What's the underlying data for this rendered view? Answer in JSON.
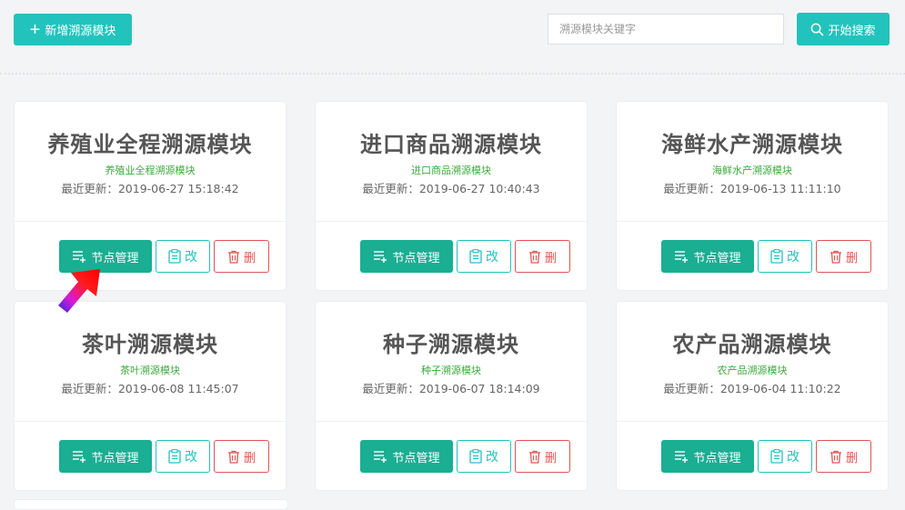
{
  "toolbar": {
    "add_label": "新增溯源模块",
    "search_placeholder": "溯源模块关键字",
    "search_label": "开始搜索"
  },
  "card_actions": {
    "node_label": "节点管理",
    "edit_label": "改",
    "delete_label": "删"
  },
  "cards": [
    {
      "title": "养殖业全程溯源模块",
      "subtitle": "养殖业全程溯源模块",
      "updated": "最近更新：2019-06-27 15:18:42"
    },
    {
      "title": "进口商品溯源模块",
      "subtitle": "进口商品溯源模块",
      "updated": "最近更新：2019-06-27 10:40:43"
    },
    {
      "title": "海鲜水产溯源模块",
      "subtitle": "海鲜水产溯源模块",
      "updated": "最近更新：2019-06-13 11:11:10"
    },
    {
      "title": "茶叶溯源模块",
      "subtitle": "茶叶溯源模块",
      "updated": "最近更新：2019-06-08 11:45:07"
    },
    {
      "title": "种子溯源模块",
      "subtitle": "种子溯源模块",
      "updated": "最近更新：2019-06-07 18:14:09"
    },
    {
      "title": "农产品溯源模块",
      "subtitle": "农产品溯源模块",
      "updated": "最近更新：2019-06-04 11:10:22"
    }
  ],
  "icons": {
    "add": "plus-icon",
    "search": "search-icon",
    "node": "list-plus-icon",
    "edit": "clipboard-icon",
    "delete": "trash-icon",
    "cursor": "red-arrow-cursor-icon"
  },
  "colors": {
    "accent": "#22c3bd",
    "node_button": "#1aae93",
    "danger": "#e05555",
    "subtitle_green": "#3cab3c"
  }
}
